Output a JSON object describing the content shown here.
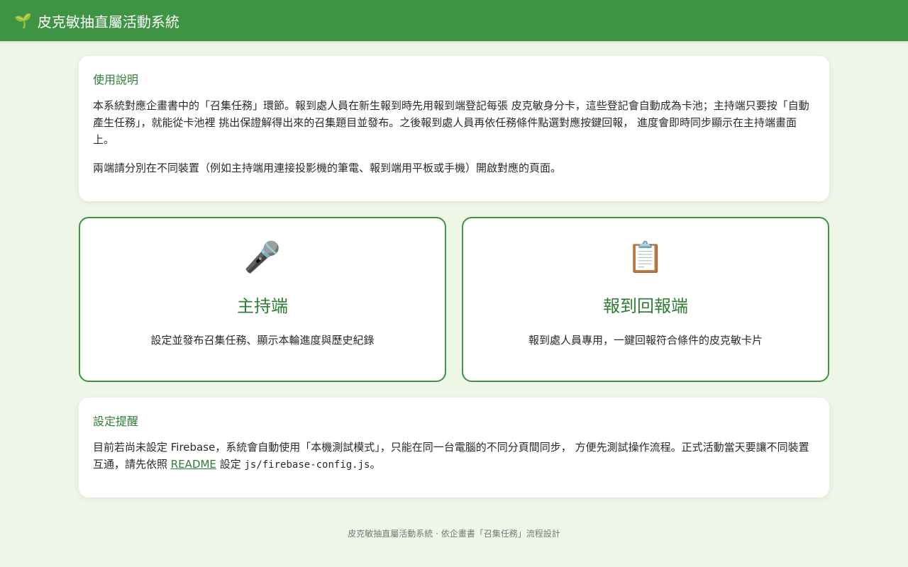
{
  "header": {
    "logo_glyph": "🌱",
    "title": "皮克敏抽直屬活動系統"
  },
  "intro": {
    "heading": "使用說明",
    "paragraph1": "本系統對應企畫書中的「召集任務」環節。報到處人員在新生報到時先用報到端登記每張 皮克敏身分卡，這些登記會自動成為卡池；主持端只要按「自動產生任務」，就能從卡池裡 挑出保證解得出來的召集題目並發布。之後報到處人員再依任務條件點選對應按鍵回報， 進度會即時同步顯示在主持端畫面上。",
    "paragraph2": "兩端請分別在不同裝置（例如主持端用連接投影機的筆電、報到端用平板或手機）開啟對應的頁面。"
  },
  "roles": [
    {
      "icon": "microphone-icon",
      "glyph": "🎤",
      "title": "主持端",
      "description": "設定並發布召集任務、顯示本輪進度與歷史紀錄"
    },
    {
      "icon": "clipboard-icon",
      "glyph": "📋",
      "title": "報到回報端",
      "description": "報到處人員專用，一鍵回報符合條件的皮克敏卡片"
    }
  ],
  "notice": {
    "heading": "設定提醒",
    "text_before_link": "目前若尚未設定 Firebase，系統會自動使用「本機測試模式」，只能在同一台電腦的不同分頁間同步， 方便先測試操作流程。正式活動當天要讓不同裝置互通，請先依照 ",
    "link_label": "README",
    "text_middle": " 設定 ",
    "code": "js/firebase-config.js",
    "text_end": "。"
  },
  "footer": {
    "text": "皮克敏抽直屬活動系統 · 依企畫書「召集任務」流程設計"
  },
  "colors": {
    "header_bg": "#3e9442",
    "accent": "#2e7d32",
    "page_bg": "#eef6e8"
  }
}
